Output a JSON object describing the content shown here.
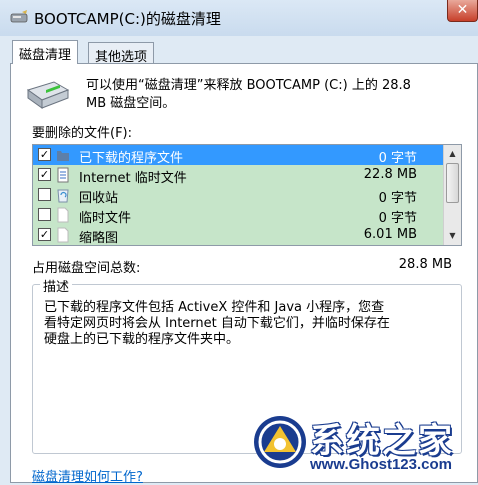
{
  "window": {
    "title": "BOOTCAMP(C:)的磁盘清理",
    "close_label": "✕"
  },
  "tabs": [
    {
      "label": "磁盘清理",
      "active": true
    },
    {
      "label": "其他选项",
      "active": false
    }
  ],
  "info": {
    "text": "可以使用“磁盘清理”来释放 BOOTCAMP (C:) 上的 28.8\nMB 磁盘空间。"
  },
  "files_label": "要删除的文件(F):",
  "files": [
    {
      "name": "已下载的程序文件",
      "size": "0 字节",
      "checked": true,
      "selected": true,
      "icon": "folder-icon"
    },
    {
      "name": "Internet 临时文件",
      "size": "22.8 MB",
      "checked": true,
      "selected": false,
      "icon": "document-icon"
    },
    {
      "name": "回收站",
      "size": "0 字节",
      "checked": false,
      "selected": false,
      "icon": "recycle-bin-icon"
    },
    {
      "name": "临时文件",
      "size": "0 字节",
      "checked": false,
      "selected": false,
      "icon": "file-icon"
    },
    {
      "name": "缩略图",
      "size": "6.01 MB",
      "checked": true,
      "selected": false,
      "icon": "file-icon"
    }
  ],
  "total": {
    "label": "占用磁盘空间总数:",
    "value": "28.8 MB"
  },
  "description": {
    "title": "描述",
    "text": "已下载的程序文件包括 ActiveX 控件和 Java 小程序，您查\n看特定网页时将会从 Internet 自动下载它们，并临时保存在\n硬盘上的已下载的程序文件夹中。"
  },
  "help_link": "磁盘清理如何工作?",
  "watermark": {
    "title": "系统之家",
    "url": "www.Ghost123.com"
  },
  "colors": {
    "selection": "#3399ff",
    "row_highlight": "#c6e5c9",
    "link": "#0066cc",
    "watermark_blue": "#1a3c8f"
  }
}
